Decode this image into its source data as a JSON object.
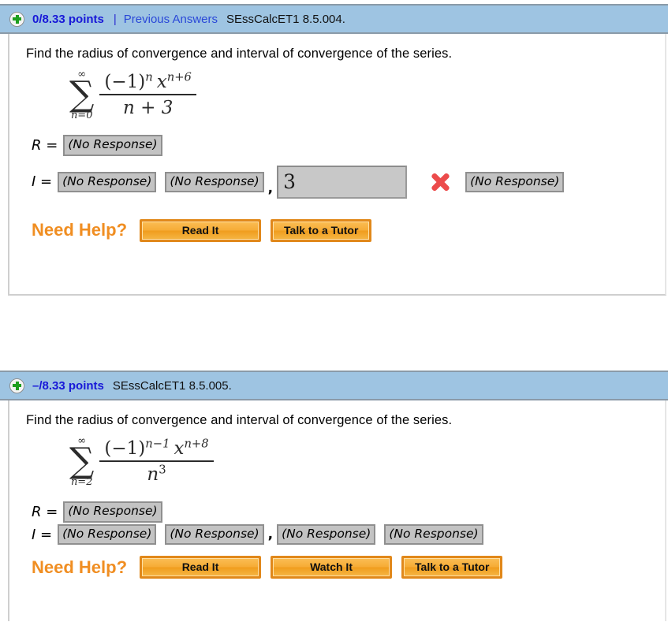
{
  "problems": [
    {
      "header": {
        "plus_icon": "plus-circle-icon",
        "points": "0/8.33 points",
        "separator": "|",
        "previous_answers": "Previous Answers",
        "assignment_id": "SEssCalcET1 8.5.004."
      },
      "question": "Find the radius of convergence and interval of convergence of the series.",
      "formula": {
        "sigma_top": "∞",
        "sigma_bot": "n=0",
        "numerator_base": "(−1)",
        "numerator_exp": "n",
        "numerator_var": "x",
        "numerator_var_exp": "n+6",
        "denominator": "n + 3"
      },
      "answers": {
        "r_label": "R =",
        "r_value": "(No Response)",
        "i_label": "I =",
        "i_field_1": "(No Response)",
        "i_field_2": "(No Response)",
        "comma": ",",
        "i_field_3_value": "3",
        "i_field_3_placeholder": "",
        "mark": "incorrect-x-icon",
        "i_field_4": "(No Response)"
      },
      "help": {
        "label": "Need Help?",
        "buttons": [
          "Read It",
          "Talk to a Tutor"
        ]
      }
    },
    {
      "header": {
        "plus_icon": "plus-circle-icon",
        "points": "–/8.33 points",
        "separator": "",
        "previous_answers": "",
        "assignment_id": "SEssCalcET1 8.5.005."
      },
      "question": "Find the radius of convergence and interval of convergence of the series.",
      "formula": {
        "sigma_top": "∞",
        "sigma_bot": "n=2",
        "numerator_base": "(−1)",
        "numerator_exp": "n−1",
        "numerator_var": "x",
        "numerator_var_exp": "n+8",
        "denominator_base": "n",
        "denominator_exp": "3"
      },
      "answers": {
        "r_label": "R =",
        "r_value": "(No Response)",
        "i_label": "I =",
        "i_field_1": "(No Response)",
        "i_field_2": "(No Response)",
        "comma": ",",
        "i_field_3": "(No Response)",
        "i_field_4": "(No Response)"
      },
      "help": {
        "label": "Need Help?",
        "buttons": [
          "Read It",
          "Watch It",
          "Talk to a Tutor"
        ]
      }
    }
  ],
  "colors": {
    "header_bar": "#9ec4e2",
    "points_text": "#1818d8",
    "link": "#2a48d8",
    "need_help": "#f08e22",
    "button": "#f5ae3a",
    "incorrect_mark": "#ec4b4b",
    "field_bg": "#c3c3c3"
  }
}
